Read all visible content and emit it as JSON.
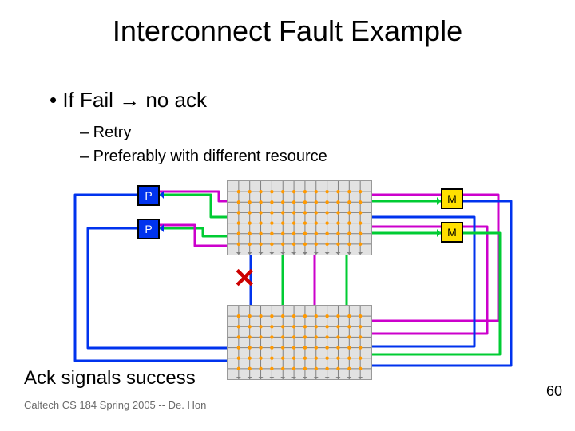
{
  "title": "Interconnect Fault Example",
  "bullets": {
    "main": "•  If Fail → no ack",
    "sub1": "–  Retry",
    "sub2": "–  Preferably with different resource"
  },
  "nodes": {
    "p1": "P",
    "p2": "P",
    "m1": "M",
    "m2": "M"
  },
  "fault_mark": "✕",
  "ack_text": "Ack signals success",
  "footer": "Caltech CS 184 Spring 2005 -- De. Hon",
  "page_number": "60",
  "colors": {
    "wire_blue": "#0033ee",
    "wire_green": "#00cc33",
    "wire_magenta": "#cc00cc",
    "crossbar_bg": "#e2e2e2",
    "dot": "#ff9900",
    "tick": "#808080"
  },
  "crossbar": {
    "cols": 12,
    "rows": 6
  }
}
